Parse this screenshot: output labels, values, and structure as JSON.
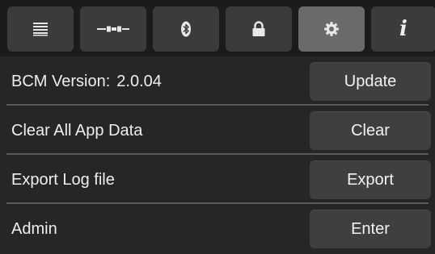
{
  "tabs": [
    {
      "icon": "list-icon",
      "active": false
    },
    {
      "icon": "connector-icon",
      "active": false
    },
    {
      "icon": "bluetooth-icon",
      "active": false
    },
    {
      "icon": "lock-icon",
      "active": false
    },
    {
      "icon": "gear-icon",
      "active": true
    },
    {
      "icon": "info-icon",
      "active": false,
      "glyph": "i"
    }
  ],
  "rows": [
    {
      "label": "BCM Version:",
      "value": "2.0.04",
      "button": "Update"
    },
    {
      "label": "Clear All App Data",
      "button": "Clear"
    },
    {
      "label": "Export Log file",
      "button": "Export"
    },
    {
      "label": "Admin",
      "button": "Enter"
    }
  ],
  "colors": {
    "background": "#262626",
    "tab_bar": "#1b1b1b",
    "tab": "#3b3b3b",
    "tab_active": "#6a6a6a",
    "button": "#3f3f3f",
    "divider": "#5a5a5a",
    "text": "#eeeeee"
  }
}
